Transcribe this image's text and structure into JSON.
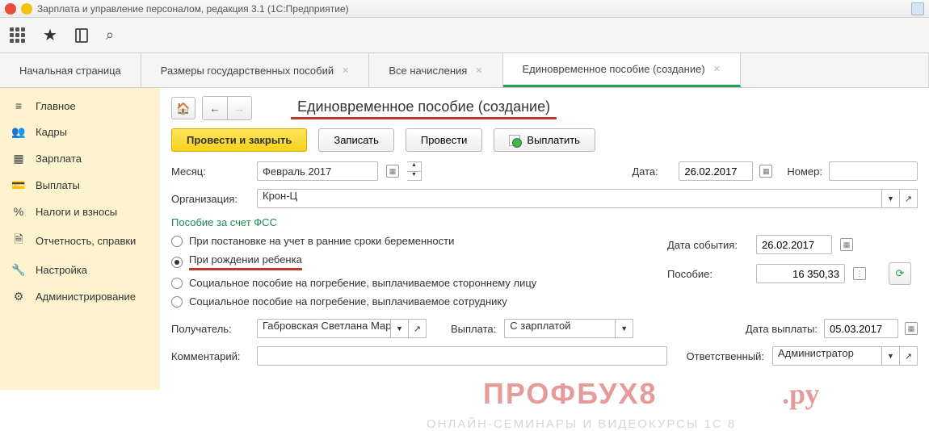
{
  "window": {
    "title": "Зарплата и управление персоналом, редакция 3.1  (1С:Предприятие)"
  },
  "tabs": {
    "home": "Начальная страница",
    "t1": "Размеры государственных пособий",
    "t2": "Все начисления",
    "t3": "Единовременное пособие (создание)"
  },
  "sidebar": {
    "main": "Главное",
    "kadry": "Кадры",
    "zarplata": "Зарплата",
    "vyplaty": "Выплаты",
    "nalogi": "Налоги и взносы",
    "otch": "Отчетность, справки",
    "nastr": "Настройка",
    "admin": "Администрирование"
  },
  "page": {
    "title": "Единовременное пособие (создание)",
    "btn_primary": "Провести и закрыть",
    "btn_save": "Записать",
    "btn_post": "Провести",
    "btn_pay": "Выплатить"
  },
  "form": {
    "month_label": "Месяц:",
    "month_value": "Февраль 2017",
    "date_label": "Дата:",
    "date_value": "26.02.2017",
    "number_label": "Номер:",
    "number_value": "",
    "org_label": "Организация:",
    "org_value": "Крон-Ц",
    "section": "Пособие за счет ФСС",
    "radio1": "При постановке на учет в ранние сроки беременности",
    "radio2": "При рождении ребенка",
    "radio3": "Социальное пособие на погребение, выплачиваемое стороннему лицу",
    "radio4": "Социальное пособие на погребение, выплачиваемое сотруднику",
    "event_date_label": "Дата события:",
    "event_date_value": "26.02.2017",
    "amount_label": "Пособие:",
    "amount_value": "16 350,33",
    "recipient_label": "Получатель:",
    "recipient_value": "Габровская Светлана Марк",
    "payout_label": "Выплата:",
    "payout_value": "С зарплатой",
    "payout_date_label": "Дата выплаты:",
    "payout_date_value": "05.03.2017",
    "comment_label": "Комментарий:",
    "comment_value": "",
    "responsible_label": "Ответственный:",
    "responsible_value": "Администратор"
  },
  "watermark": {
    "w1": "ПРОФБУХ8",
    "w2": ".ру",
    "w3": "ОНЛАЙН-СЕМИНАРЫ И ВИДЕОКУРСЫ 1С 8"
  }
}
